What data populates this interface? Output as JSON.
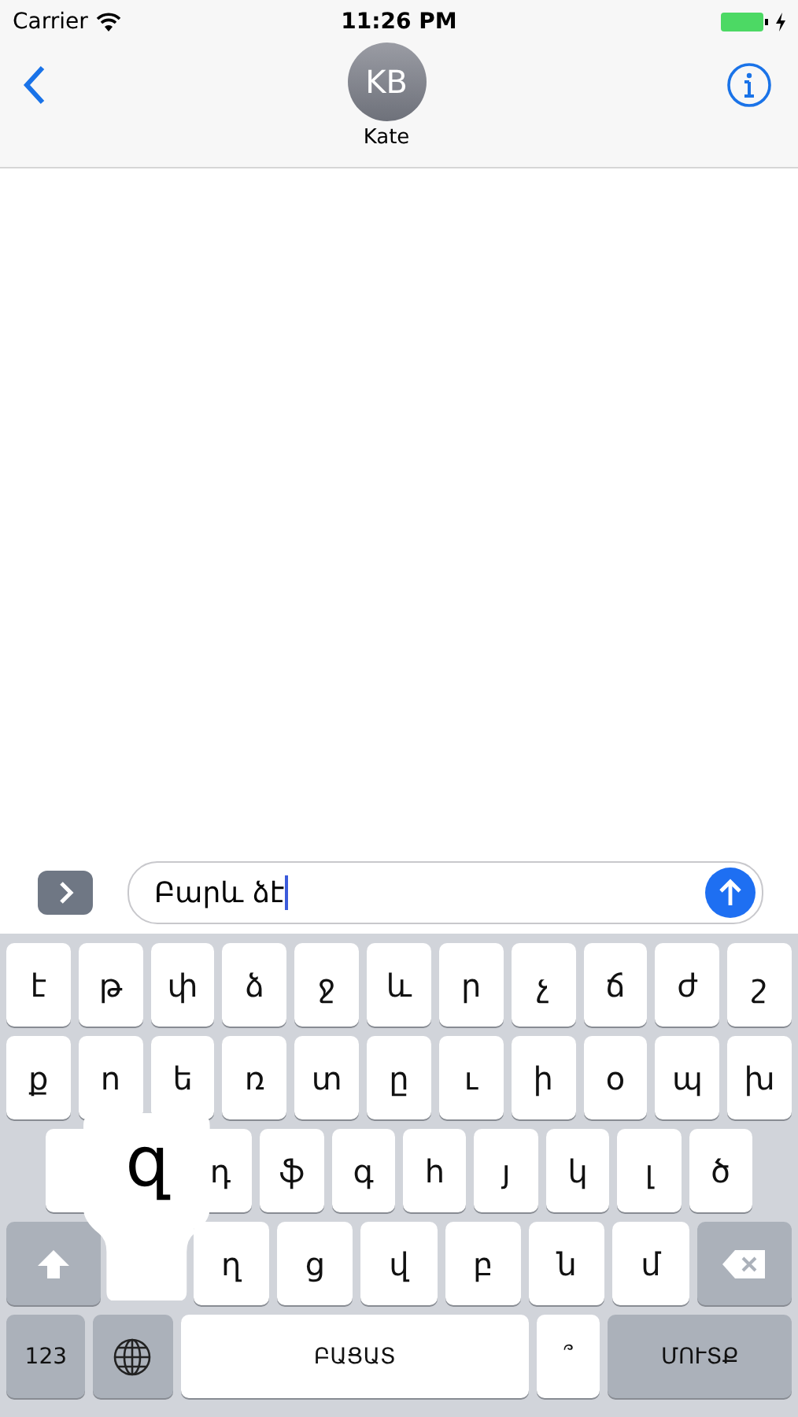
{
  "status_bar": {
    "carrier": "Carrier",
    "time": "11:26 PM"
  },
  "nav": {
    "initials": "KB",
    "name": "Kate"
  },
  "composer": {
    "value": "Բարև ձէ"
  },
  "keyboard": {
    "rows": [
      {
        "keys": [
          {
            "kind": "letter",
            "label": "է"
          },
          {
            "kind": "letter",
            "label": "թ"
          },
          {
            "kind": "letter",
            "label": "փ"
          },
          {
            "kind": "letter",
            "label": "ձ"
          },
          {
            "kind": "letter",
            "label": "ջ"
          },
          {
            "kind": "letter",
            "label": "և"
          },
          {
            "kind": "letter",
            "label": "ր"
          },
          {
            "kind": "letter",
            "label": "չ"
          },
          {
            "kind": "letter",
            "label": "ճ"
          },
          {
            "kind": "letter",
            "label": "ժ"
          },
          {
            "kind": "letter",
            "label": "շ"
          }
        ]
      },
      {
        "keys": [
          {
            "kind": "letter",
            "label": "ք"
          },
          {
            "kind": "letter",
            "label": "ո"
          },
          {
            "kind": "letter",
            "label": "ե"
          },
          {
            "kind": "letter",
            "label": "ռ"
          },
          {
            "kind": "letter",
            "label": "տ"
          },
          {
            "kind": "letter",
            "label": "ը"
          },
          {
            "kind": "letter",
            "label": "ւ"
          },
          {
            "kind": "letter",
            "label": "ի"
          },
          {
            "kind": "letter",
            "label": "օ"
          },
          {
            "kind": "letter",
            "label": "պ"
          },
          {
            "kind": "letter",
            "label": "խ"
          }
        ]
      },
      {
        "keys": [
          {
            "kind": "blank"
          },
          {
            "kind": "hidden"
          },
          {
            "kind": "letter",
            "label": "դ"
          },
          {
            "kind": "letter",
            "label": "ֆ"
          },
          {
            "kind": "letter",
            "label": "գ"
          },
          {
            "kind": "letter",
            "label": "հ"
          },
          {
            "kind": "letter",
            "label": "յ"
          },
          {
            "kind": "letter",
            "label": "կ"
          },
          {
            "kind": "letter",
            "label": "լ"
          },
          {
            "kind": "letter",
            "label": "ծ"
          }
        ]
      },
      {
        "keys": [
          {
            "kind": "shift"
          },
          {
            "kind": "pressed",
            "label": "զ"
          },
          {
            "kind": "letter",
            "label": "ղ"
          },
          {
            "kind": "letter",
            "label": "ց"
          },
          {
            "kind": "letter",
            "label": "վ"
          },
          {
            "kind": "letter",
            "label": "բ"
          },
          {
            "kind": "letter",
            "label": "ն"
          },
          {
            "kind": "letter",
            "label": "մ"
          },
          {
            "kind": "delete"
          }
        ]
      },
      {
        "keys": [
          {
            "kind": "numbers",
            "label": "123"
          },
          {
            "kind": "globe"
          },
          {
            "kind": "space",
            "label": "ԲԱՑԱՏ"
          },
          {
            "kind": "letter",
            "label": "՞"
          },
          {
            "kind": "return",
            "label": "ՄՈՒՏՔ"
          }
        ]
      }
    ]
  }
}
